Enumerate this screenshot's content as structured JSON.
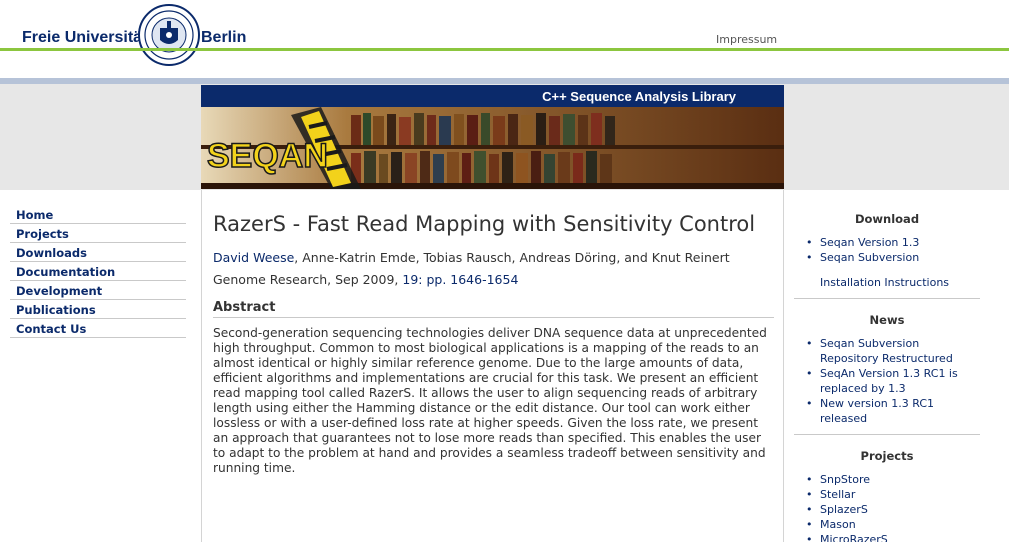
{
  "header": {
    "uni_left": "Freie Universität",
    "uni_right": "Berlin",
    "impressum": "Impressum"
  },
  "banner": {
    "subtitle": "C++ Sequence Analysis Library",
    "logo_text": "SEQAN"
  },
  "leftnav": [
    {
      "label": "Home"
    },
    {
      "label": "Projects"
    },
    {
      "label": "Downloads"
    },
    {
      "label": "Documentation"
    },
    {
      "label": "Development"
    },
    {
      "label": "Publications"
    },
    {
      "label": "Contact Us"
    }
  ],
  "article": {
    "title": "RazerS - Fast Read Mapping with Sensitivity Control",
    "first_author": "David Weese",
    "other_authors": ", Anne-Katrin Emde, Tobias Rausch, Andreas Döring, and Knut Reinert",
    "journal": "Genome Research, Sep 2009, ",
    "pages": "19: pp. 1646-1654",
    "abstract_heading": "Abstract",
    "abstract": "Second-generation sequencing technologies deliver DNA sequence data at unprecedented high throughput. Common to most biological applications is a mapping of the reads to an almost identical or highly similar reference genome. Due to the large amounts of data, efficient algorithms and implementations are crucial for this task. We present an efficient read mapping tool called RazerS. It allows the user to align sequencing reads of arbitrary length using either the Hamming distance or the edit distance. Our tool can work either lossless or with a user-defined loss rate at higher speeds. Given the loss rate, we present an approach that guarantees not to lose more reads than specified. This enables the user to adapt to the problem at hand and provides a seamless tradeoff between sensitivity and running time."
  },
  "right": {
    "download": {
      "heading": "Download",
      "items": [
        "Seqan Version 1.3",
        "Seqan Subversion"
      ],
      "extra": "Installation Instructions"
    },
    "news": {
      "heading": "News",
      "items": [
        "Seqan Subversion Repository Restructured",
        "SeqAn Version 1.3 RC1 is replaced by 1.3",
        "New version 1.3 RC1 released"
      ]
    },
    "projects": {
      "heading": "Projects",
      "items": [
        "SnpStore",
        "Stellar",
        "SplazerS",
        "Mason",
        "MicroRazerS"
      ]
    }
  },
  "colors": {
    "navy": "#0b2a6b",
    "green": "#8cc63f",
    "gold": "#f2d21b"
  }
}
